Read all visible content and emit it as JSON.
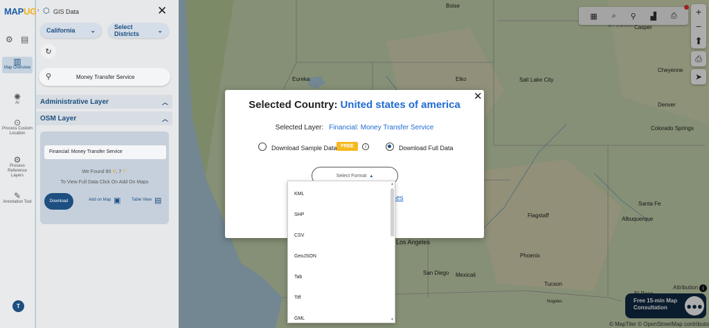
{
  "rail": {
    "logo_main": "MAP",
    "logo_accent": "UG",
    "items": [
      {
        "label": "Map Overview",
        "icon": "map-icon",
        "active": true
      },
      {
        "label": "AI",
        "icon": "ai-icon",
        "active": false
      },
      {
        "label": "Process Custom Location",
        "icon": "location-icon",
        "active": false
      },
      {
        "label": "Process Reference Layers",
        "icon": "layers-icon",
        "active": false
      },
      {
        "label": "Annotation Tool",
        "icon": "annotation-icon",
        "active": false
      }
    ],
    "avatar": "T"
  },
  "panel": {
    "title": "GIS Data",
    "state": "California",
    "districts": "Select Districts",
    "search_value": "Money Transfer Service",
    "admin_layer": "Administrative Layer",
    "osm_layer": "OSM Layer",
    "card_field": "Financial: Money Transfer Service",
    "found_prefix": "We Found",
    "found_count1": "80",
    "found_count2": "7",
    "view_msg": "To View Full Data Click On Add On Maps",
    "download": "Download",
    "add_on_map": "Add on Map",
    "table_view": "Table View"
  },
  "map": {
    "cities": [
      {
        "name": "Boise"
      },
      {
        "name": "Casper"
      },
      {
        "name": "Eureka"
      },
      {
        "name": "Elko"
      },
      {
        "name": "Salt Lake City"
      },
      {
        "name": "Cheyenne"
      },
      {
        "name": "Denver"
      },
      {
        "name": "Colorado Springs"
      },
      {
        "name": "Santa Fe"
      },
      {
        "name": "Flagstaff"
      },
      {
        "name": "Albuquerque"
      },
      {
        "name": "Los Angeles"
      },
      {
        "name": "Phoenix"
      },
      {
        "name": "San Diego"
      },
      {
        "name": "Mexicali"
      },
      {
        "name": "Tucson"
      },
      {
        "name": "El Paso"
      },
      {
        "name": "Nogales"
      },
      {
        "name": "WYOMING"
      }
    ],
    "attribution": "Attribution",
    "copyright": "© MapTiler © OpenStreetMap contributors",
    "consult_line1": "Free 15-min Map",
    "consult_line2": "Consultation"
  },
  "modal": {
    "title_prefix": "Selected Country:",
    "country": "United states of america",
    "layer_label": "Selected Layer:",
    "layer_value": "Financial: Money Transfer Service",
    "sample_label": "Download Sample Data",
    "free_badge": "FREE",
    "full_label": "Download Full Data",
    "selected_option": "full",
    "format_placeholder": "Select Format",
    "partial_link": "ses"
  },
  "dropdown": {
    "options": [
      "KML",
      "SHP",
      "CSV",
      "GeoJSON",
      "Tab",
      "Tiff",
      "GML"
    ]
  },
  "colors": {
    "brand": "#1d4f80",
    "accent": "#f2b01e",
    "link": "#1e6bd0"
  }
}
